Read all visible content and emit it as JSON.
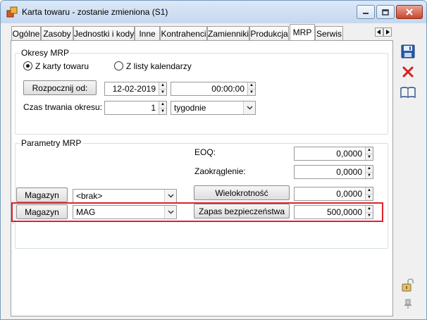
{
  "window": {
    "title": "Karta towaru - zostanie zmieniona (S1)"
  },
  "tabs": [
    {
      "label": "Ogólne"
    },
    {
      "label": "Zasoby"
    },
    {
      "label": "Jednostki i kody"
    },
    {
      "label": "Inne"
    },
    {
      "label": "Kontrahenci"
    },
    {
      "label": "Zamienniki"
    },
    {
      "label": "Produkcja"
    },
    {
      "label": "MRP",
      "active": true
    },
    {
      "label": "Serwis"
    }
  ],
  "okresy": {
    "legend": "Okresy MRP",
    "radio_karta": "Z karty towaru",
    "radio_listy": "Z listy kalendarzy",
    "start_button": "Rozpocznij od:",
    "start_date": "12-02-2019",
    "start_time": "00:00:00",
    "duration_label": "Czas trwania okresu:",
    "duration_value": "1",
    "duration_unit": "tygodnie"
  },
  "parametry": {
    "legend": "Parametry MRP",
    "eoq_label": "EOQ:",
    "eoq_value": "0,0000",
    "zaokraglenie_label": "Zaokrąglenie:",
    "zaokraglenie_value": "0,0000",
    "magazyn1_button": "Magazyn",
    "magazyn1_value": "<brak>",
    "wielokrotnosc_button": "Wielokrotność",
    "wielokrotnosc_value": "0,0000",
    "magazyn2_button": "Magazyn",
    "magazyn2_value": "MAG",
    "zapas_button": "Zapas bezpieczeństwa",
    "zapas_value": "500,0000"
  },
  "colors": {
    "highlight": "#e0202a",
    "save_icon": "#2a5aa8",
    "delete_icon": "#d42020"
  },
  "icons": {
    "save": "save-icon",
    "delete": "delete-icon",
    "help": "book-icon",
    "lock": "lock-icon",
    "pin": "pin-icon"
  }
}
